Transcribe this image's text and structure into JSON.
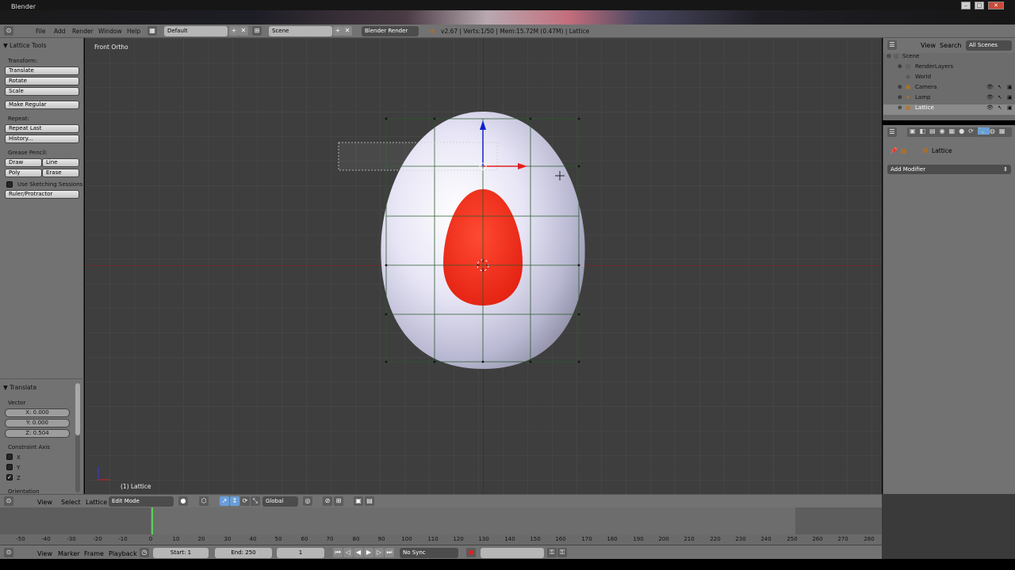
{
  "window": {
    "title": "Blender",
    "controls": [
      "–",
      "□",
      "✕"
    ]
  },
  "topbar": {
    "menus": [
      "File",
      "Add",
      "Render",
      "Window",
      "Help"
    ],
    "screen": "Default",
    "scene": "Scene",
    "engine": "Blender Render",
    "info": "v2.67 | Verts:1/50 | Mem:15.72M (0.47M) | Lattice"
  },
  "toolshelf": {
    "title": "Lattice Tools",
    "transform_label": "Transform:",
    "transform_buttons": [
      "Translate",
      "Rotate",
      "Scale"
    ],
    "make_regular": "Make Regular",
    "repeat_label": "Repeat:",
    "repeat_buttons": [
      "Repeat Last",
      "History..."
    ],
    "grease_label": "Grease Pencil:",
    "grease_buttons": [
      "Draw",
      "Line",
      "Poly",
      "Erase"
    ],
    "sketching": "Use Sketching Sessions",
    "ruler": "Ruler/Protractor"
  },
  "operator": {
    "title": "Translate",
    "vector_label": "Vector",
    "x": "X: 0.000",
    "y": "Y: 0.000",
    "z": "Z: 0.504",
    "constraint_label": "Constraint Axis",
    "axes": [
      "X",
      "Y",
      "Z"
    ],
    "axes_checked": [
      false,
      false,
      true
    ],
    "orientation_label": "Orientation"
  },
  "viewport": {
    "view_name": "Front Ortho",
    "object_label": "(1) Lattice"
  },
  "outliner": {
    "view": "View",
    "search": "Search",
    "filter": "All Scenes",
    "items": [
      "Scene",
      "RenderLayers",
      "World",
      "Camera",
      "Lamp",
      "Lattice"
    ]
  },
  "properties": {
    "object": "Lattice",
    "add_modifier": "Add Modifier"
  },
  "view_header": {
    "menus": [
      "View",
      "Select",
      "Lattice"
    ],
    "mode": "Edit Mode",
    "orientation": "Global"
  },
  "timeline": {
    "ticks": [
      "-50",
      "-40",
      "-30",
      "-20",
      "-10",
      "0",
      "10",
      "20",
      "30",
      "40",
      "50",
      "60",
      "70",
      "80",
      "90",
      "100",
      "110",
      "120",
      "130",
      "140",
      "150",
      "160",
      "170",
      "180",
      "190",
      "200",
      "210",
      "220",
      "230",
      "240",
      "250",
      "260",
      "270",
      "280"
    ]
  },
  "timeline_header": {
    "menus": [
      "View",
      "Marker",
      "Frame",
      "Playback"
    ],
    "start": "Start: 1",
    "end": "End: 250",
    "current": "1",
    "sync": "No Sync"
  },
  "colors": {
    "panel": "#727272",
    "viewport": "#3e3e3e",
    "x_axis": "#e02020",
    "y_axis": "#1020d0",
    "egg_red": "#f0301e"
  }
}
